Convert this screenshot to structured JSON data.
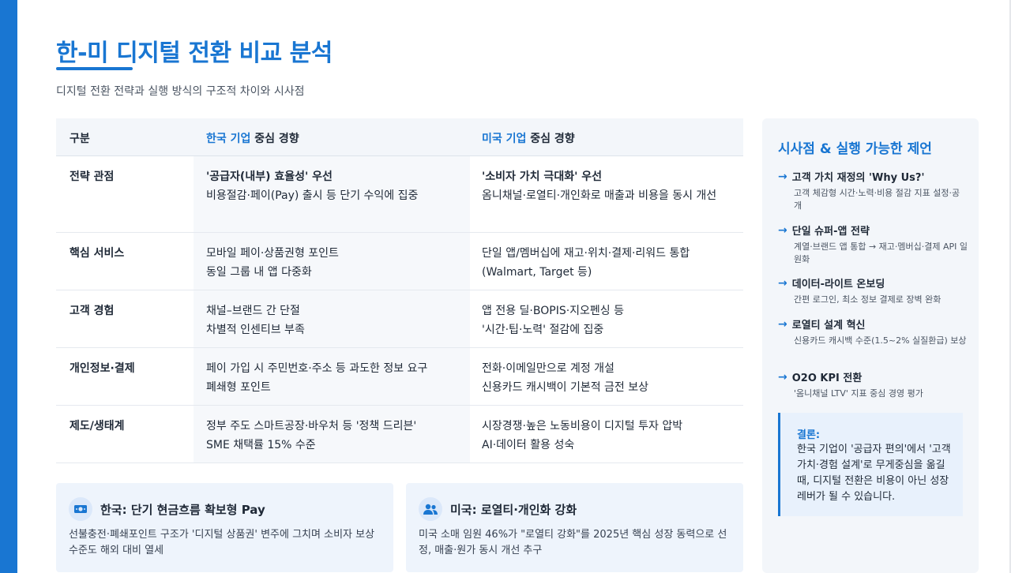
{
  "header": {
    "title": "한-미 디지털 전환 비교 분석",
    "subtitle": "디지털 전환 전략과 실행 방식의 구조적 차이와 시사점"
  },
  "table": {
    "headers": {
      "category": "구분",
      "korea_prefix": "한국 기업",
      "korea_suffix": " 중심 경향",
      "us_prefix": "미국 기업",
      "us_suffix": " 중심 경향"
    },
    "rows": [
      {
        "category": "전략 관점",
        "korea": [
          "'공급자(내부) 효율성' 우선",
          "비용절감·페이(Pay) 출시 등 단기 수익에 집중"
        ],
        "us": [
          "'소비자 가치 극대화' 우선",
          "옴니채널·로열티·개인화로 매출과 비용을 동시 개선"
        ]
      },
      {
        "category": "핵심 서비스",
        "korea": [
          "모바일 페이·상품권형 포인트",
          "동일 그룹 내 앱 다중화"
        ],
        "us": [
          "단일 앱/멤버십에 재고·위치·결제·리워드 통합",
          "(Walmart, Target 등)"
        ]
      },
      {
        "category": "고객 경험",
        "korea": [
          "채널–브랜드 간 단절",
          "차별적 인센티브 부족"
        ],
        "us": [
          "앱 전용 딜·BOPIS·지오펜싱 등",
          "'시간·팁·노력' 절감에 집중"
        ]
      },
      {
        "category": "개인정보·결제",
        "korea": [
          "페이 가입 시 주민번호·주소 등 과도한 정보 요구",
          "폐쇄형 포인트"
        ],
        "us": [
          "전화·이메일만으로 계정 개설",
          "신용카드 캐시백이 기본적 금전 보상"
        ]
      },
      {
        "category": "제도/생태계",
        "korea": [
          "정부 주도 스마트공장·바우처 등 '정책 드리븐'",
          "SME 채택률 15% 수준"
        ],
        "us": [
          "시장경쟁·높은 노동비용이 디지털 투자 압박",
          "AI·데이터 활용 성숙"
        ]
      }
    ]
  },
  "cards": [
    {
      "icon": "money-icon",
      "title": "한국: 단기 현금흐름 확보형 Pay",
      "body": "선불충전·폐쇄포인트 구조가 '디지털 상품권' 변주에 그치며 소비자 보상 수준도 해외 대비 열세"
    },
    {
      "icon": "users-icon",
      "title": "미국: 로열티·개인화 강화",
      "body": "미국 소매 임원 46%가 \"로열티 강화\"를 2025년 핵심 성장 동력으로 선정, 매출·원가 동시 개선 추구"
    }
  ],
  "panel": {
    "title": "시사점 & 실행 가능한 제언",
    "recommendations": [
      {
        "title": "고객 가치 재정의 'Why Us?'",
        "desc": "고객 체감형 시간·노력·비용 절감 지표 설정·공개"
      },
      {
        "title": "단일 슈퍼-앱 전략",
        "desc": "계열·브랜드 앱 통합 → 재고·멤버십·결제 API 일원화"
      },
      {
        "title": "데이터-라이트 온보딩",
        "desc": "간편 로그인, 최소 정보 결제로 장벽 완화"
      },
      {
        "title": "로열티 설계 혁신",
        "desc": "신용카드 캐시백 수준(1.5~2% 실질환급) 보상"
      },
      {
        "title": "O2O KPI 전환",
        "desc": "'옴니채널 LTV' 지표 중심 경영 평가"
      }
    ],
    "conclusion": {
      "label": "결론:",
      "body": "한국 기업이 '공급자 편의'에서 '고객 가치·경험 설계'로 무게중심을 옮길 때, 디지털 전환은 비용이 아닌 성장 레버가 될 수 있습니다."
    }
  },
  "colors": {
    "accent": "#1976d2",
    "panel_bg": "#f3f6fa",
    "card_bg": "#eef4fc"
  }
}
